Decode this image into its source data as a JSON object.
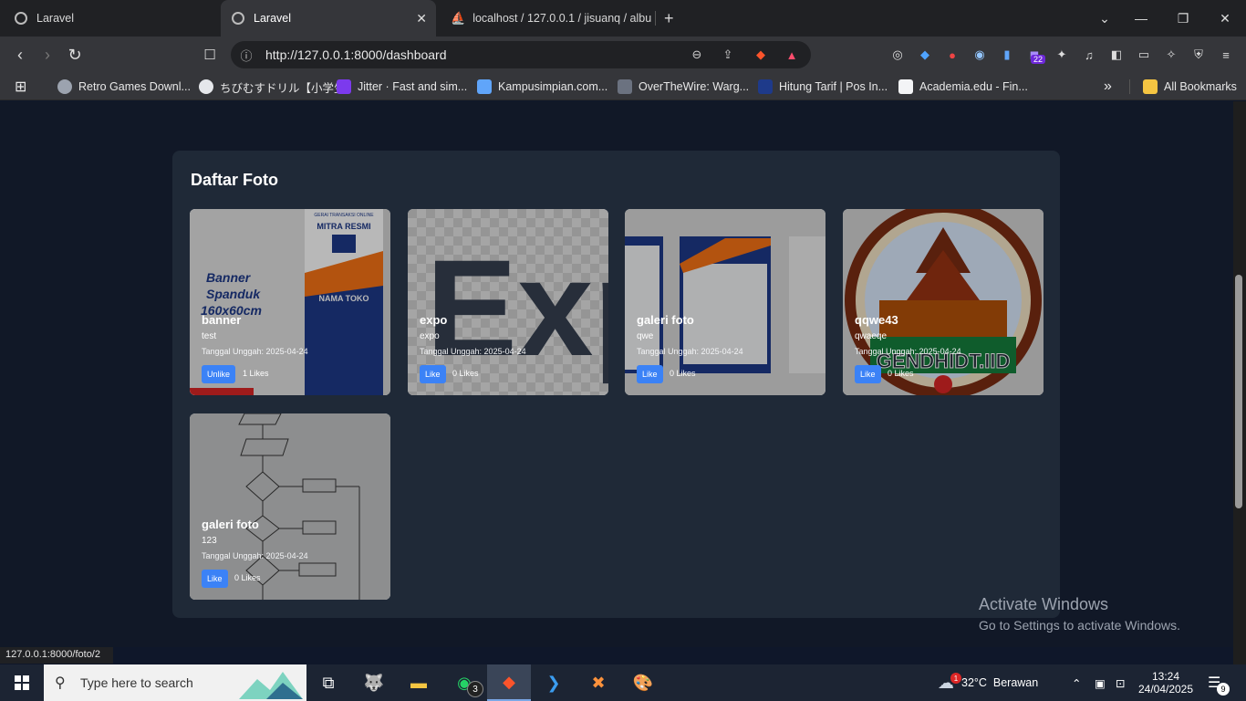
{
  "browser": {
    "tabs": [
      {
        "title": "Laravel"
      },
      {
        "title": "Laravel"
      },
      {
        "title": "localhost / 127.0.0.1 / jisuanq / albu"
      }
    ],
    "new_tab": "+",
    "address": "http://127.0.0.1:8000/dashboard",
    "extension_badge": "22",
    "bookmarks": [
      {
        "label": "Retro Games Downl..."
      },
      {
        "label": "ちびむすドリル【小学生】"
      },
      {
        "label": "Jitter · Fast and sim..."
      },
      {
        "label": "Kampusimpian.com..."
      },
      {
        "label": "OverTheWire: Warg..."
      },
      {
        "label": "Hitung Tarif | Pos In..."
      },
      {
        "label": "Academia.edu - Fin..."
      }
    ],
    "more": "»",
    "all_bookmarks": "All Bookmarks",
    "status_url": "127.0.0.1:8000/foto/2"
  },
  "page": {
    "heading": "Daftar Foto",
    "photos": [
      {
        "title": "banner",
        "description": "test",
        "date": "Tanggal Unggah: 2025-04-24",
        "button": "Unlike",
        "likes": "1 Likes",
        "banner_text": "GERAI TRANSAKSI ONLINE",
        "banner_brand": "MITRA RESMI",
        "banner_store": "NAMA TOKO",
        "art_lines": [
          "Banner",
          "Spanduk",
          "160x60cm"
        ]
      },
      {
        "title": "expo",
        "description": "expo",
        "date": "Tanggal Unggah: 2025-04-24",
        "button": "Like",
        "likes": "0 Likes",
        "art_text": "Exp"
      },
      {
        "title": "galeri foto",
        "description": "qwe",
        "date": "Tanggal Unggah: 2025-04-24",
        "button": "Like",
        "likes": "0 Likes"
      },
      {
        "title": "qqwe43",
        "description": "qwaeqe",
        "date": "Tanggal Unggah: 2025-04-24",
        "button": "Like",
        "likes": "0 Likes",
        "art_text": "GENDHIDT.IID"
      },
      {
        "title": "galeri foto",
        "description": "123",
        "date": "Tanggal Unggah: 2025-04-24",
        "button": "Like",
        "likes": "0 Likes"
      }
    ]
  },
  "windows": {
    "activate_title": "Activate Windows",
    "activate_sub": "Go to Settings to activate Windows.",
    "search_placeholder": "Type here to search",
    "whatsapp_badge": "3",
    "weather": "32°C  Berawan",
    "weather_badge": "1",
    "time": "13:24",
    "date": "24/04/2025",
    "notif_badge": "9"
  },
  "colors": {
    "accent_button": "#3b82f6",
    "panel_bg": "#1f2937",
    "page_bg": "#111827"
  }
}
